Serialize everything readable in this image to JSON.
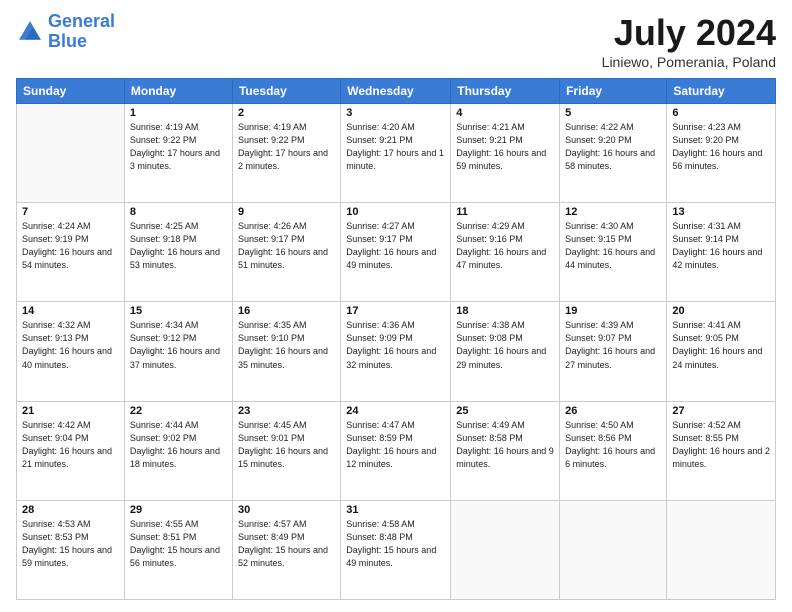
{
  "header": {
    "logo_line1": "General",
    "logo_line2": "Blue",
    "month": "July 2024",
    "location": "Liniewo, Pomerania, Poland"
  },
  "weekdays": [
    "Sunday",
    "Monday",
    "Tuesday",
    "Wednesday",
    "Thursday",
    "Friday",
    "Saturday"
  ],
  "weeks": [
    [
      {
        "day": "",
        "sunrise": "",
        "sunset": "",
        "daylight": ""
      },
      {
        "day": "1",
        "sunrise": "4:19 AM",
        "sunset": "9:22 PM",
        "daylight": "17 hours and 3 minutes."
      },
      {
        "day": "2",
        "sunrise": "4:19 AM",
        "sunset": "9:22 PM",
        "daylight": "17 hours and 2 minutes."
      },
      {
        "day": "3",
        "sunrise": "4:20 AM",
        "sunset": "9:21 PM",
        "daylight": "17 hours and 1 minute."
      },
      {
        "day": "4",
        "sunrise": "4:21 AM",
        "sunset": "9:21 PM",
        "daylight": "16 hours and 59 minutes."
      },
      {
        "day": "5",
        "sunrise": "4:22 AM",
        "sunset": "9:20 PM",
        "daylight": "16 hours and 58 minutes."
      },
      {
        "day": "6",
        "sunrise": "4:23 AM",
        "sunset": "9:20 PM",
        "daylight": "16 hours and 56 minutes."
      }
    ],
    [
      {
        "day": "7",
        "sunrise": "4:24 AM",
        "sunset": "9:19 PM",
        "daylight": "16 hours and 54 minutes."
      },
      {
        "day": "8",
        "sunrise": "4:25 AM",
        "sunset": "9:18 PM",
        "daylight": "16 hours and 53 minutes."
      },
      {
        "day": "9",
        "sunrise": "4:26 AM",
        "sunset": "9:17 PM",
        "daylight": "16 hours and 51 minutes."
      },
      {
        "day": "10",
        "sunrise": "4:27 AM",
        "sunset": "9:17 PM",
        "daylight": "16 hours and 49 minutes."
      },
      {
        "day": "11",
        "sunrise": "4:29 AM",
        "sunset": "9:16 PM",
        "daylight": "16 hours and 47 minutes."
      },
      {
        "day": "12",
        "sunrise": "4:30 AM",
        "sunset": "9:15 PM",
        "daylight": "16 hours and 44 minutes."
      },
      {
        "day": "13",
        "sunrise": "4:31 AM",
        "sunset": "9:14 PM",
        "daylight": "16 hours and 42 minutes."
      }
    ],
    [
      {
        "day": "14",
        "sunrise": "4:32 AM",
        "sunset": "9:13 PM",
        "daylight": "16 hours and 40 minutes."
      },
      {
        "day": "15",
        "sunrise": "4:34 AM",
        "sunset": "9:12 PM",
        "daylight": "16 hours and 37 minutes."
      },
      {
        "day": "16",
        "sunrise": "4:35 AM",
        "sunset": "9:10 PM",
        "daylight": "16 hours and 35 minutes."
      },
      {
        "day": "17",
        "sunrise": "4:36 AM",
        "sunset": "9:09 PM",
        "daylight": "16 hours and 32 minutes."
      },
      {
        "day": "18",
        "sunrise": "4:38 AM",
        "sunset": "9:08 PM",
        "daylight": "16 hours and 29 minutes."
      },
      {
        "day": "19",
        "sunrise": "4:39 AM",
        "sunset": "9:07 PM",
        "daylight": "16 hours and 27 minutes."
      },
      {
        "day": "20",
        "sunrise": "4:41 AM",
        "sunset": "9:05 PM",
        "daylight": "16 hours and 24 minutes."
      }
    ],
    [
      {
        "day": "21",
        "sunrise": "4:42 AM",
        "sunset": "9:04 PM",
        "daylight": "16 hours and 21 minutes."
      },
      {
        "day": "22",
        "sunrise": "4:44 AM",
        "sunset": "9:02 PM",
        "daylight": "16 hours and 18 minutes."
      },
      {
        "day": "23",
        "sunrise": "4:45 AM",
        "sunset": "9:01 PM",
        "daylight": "16 hours and 15 minutes."
      },
      {
        "day": "24",
        "sunrise": "4:47 AM",
        "sunset": "8:59 PM",
        "daylight": "16 hours and 12 minutes."
      },
      {
        "day": "25",
        "sunrise": "4:49 AM",
        "sunset": "8:58 PM",
        "daylight": "16 hours and 9 minutes."
      },
      {
        "day": "26",
        "sunrise": "4:50 AM",
        "sunset": "8:56 PM",
        "daylight": "16 hours and 6 minutes."
      },
      {
        "day": "27",
        "sunrise": "4:52 AM",
        "sunset": "8:55 PM",
        "daylight": "16 hours and 2 minutes."
      }
    ],
    [
      {
        "day": "28",
        "sunrise": "4:53 AM",
        "sunset": "8:53 PM",
        "daylight": "15 hours and 59 minutes."
      },
      {
        "day": "29",
        "sunrise": "4:55 AM",
        "sunset": "8:51 PM",
        "daylight": "15 hours and 56 minutes."
      },
      {
        "day": "30",
        "sunrise": "4:57 AM",
        "sunset": "8:49 PM",
        "daylight": "15 hours and 52 minutes."
      },
      {
        "day": "31",
        "sunrise": "4:58 AM",
        "sunset": "8:48 PM",
        "daylight": "15 hours and 49 minutes."
      },
      {
        "day": "",
        "sunrise": "",
        "sunset": "",
        "daylight": ""
      },
      {
        "day": "",
        "sunrise": "",
        "sunset": "",
        "daylight": ""
      },
      {
        "day": "",
        "sunrise": "",
        "sunset": "",
        "daylight": ""
      }
    ]
  ]
}
